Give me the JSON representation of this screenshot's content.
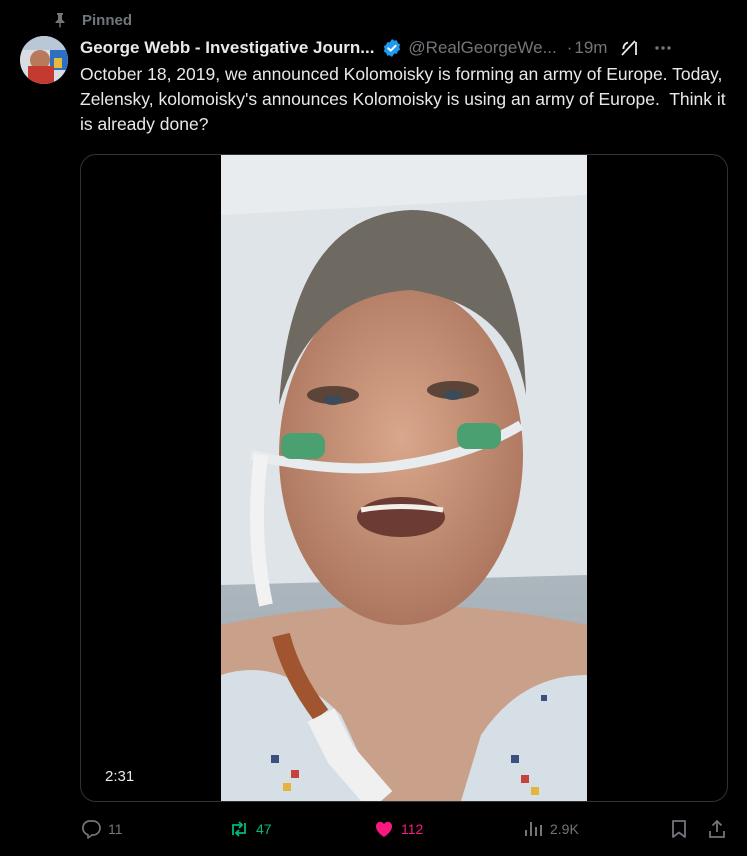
{
  "pinned": {
    "label": "Pinned",
    "icon": "pin-icon"
  },
  "author": {
    "display_name": "George Webb - Investigative Journ...",
    "handle": "@RealGeorgeWe...",
    "separator": "·",
    "time": "19m",
    "verified_color": "#1d9bf0"
  },
  "tweet": {
    "text": "October 18, 2019, we announced Kolomoisky is forming an army of Europe. Today, Zelensky, kolomoisky's announces Kolomoisky is using an army of Europe.  Think it is already done?"
  },
  "media": {
    "duration": "2:31"
  },
  "actions": {
    "replies": "11",
    "reposts": "47",
    "likes": "112",
    "views": "2.9K"
  },
  "colors": {
    "background": "#000000",
    "text": "#e7e9ea",
    "muted": "#71767b",
    "repost": "#00ba7c",
    "like": "#f91880"
  }
}
